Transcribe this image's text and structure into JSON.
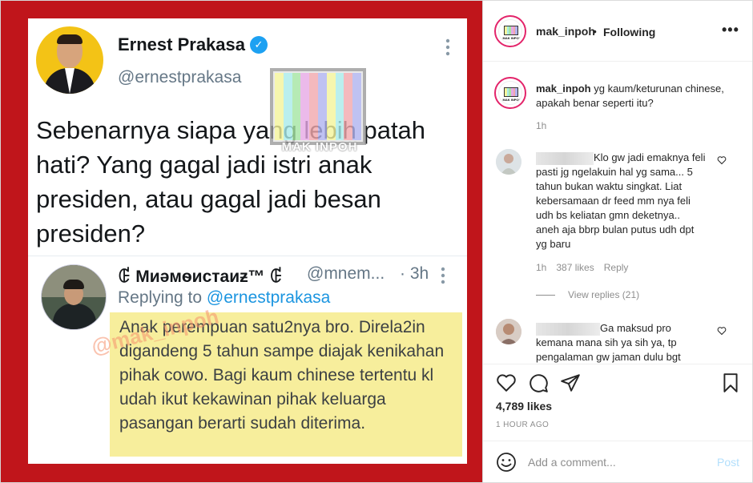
{
  "tweet": {
    "name": "Ernest Prakasa",
    "handle": "@ernestprakasa",
    "text": "Sebenarnya siapa yang lebih patah hati? Yang gagal jadi istri anak presiden, atau gagal jadi besan presiden?",
    "verified_glyph": "✓",
    "more_glyph": "⋮"
  },
  "quote": {
    "name": "ꂅ Mиәмѳиcтаиƶ™ ꂅ",
    "handle": "@mnem...",
    "time": "· 3h",
    "replying_prefix": "Replying to ",
    "replying_mention": "@ernestprakasa",
    "text": "Anak perempuan satu2nya bro. Direla2in digandeng 5 tahun sampe diajak kenikahan pihak cowo. Bagi kaum chinese tertentu kl udah ikut kekawinan pihak keluarga pasangan berarti sudah diterima.",
    "more_glyph": "⋮"
  },
  "watermark": {
    "logo_text": "MAK INPOH",
    "diagonal_text": "@mak_inpoh",
    "colors": [
      "#f4f49a",
      "#a9ecea",
      "#a5e6a3",
      "#e7a9e6",
      "#f2a8ad",
      "#b0b3f0",
      "#f4f49a",
      "#a9ecea",
      "#f2a8ad",
      "#b0b3f0"
    ]
  },
  "header": {
    "username": "mak_inpoh",
    "dot": "•",
    "follow_label": "Following",
    "more_label": "•••",
    "avatar_text": "MAK INPOH"
  },
  "caption": {
    "username": "mak_inpoh",
    "text": " yg kaum/keturunan chinese, apakah benar seperti itu?",
    "time": "1h"
  },
  "comments": [
    {
      "text": "Klo gw jadi emaknya feli pasti jg ngelakuin hal yg sama... 5 tahun bukan waktu singkat. Liat kebersamaan dr feed mm nya feli udh bs keliatan gmn deketnya.. aneh aja bbrp bulan putus udh dpt yg baru",
      "time": "1h",
      "likes": "387 likes",
      "reply": "Reply",
      "view_replies": "View replies (21)"
    },
    {
      "text": "Ga maksud pro kemana mana sih ya sih ya, tp pengalaman gw jaman dulu bgt"
    }
  ],
  "actions": {
    "likes": "4,789 likes",
    "time_ago": "1 HOUR AGO"
  },
  "add_comment": {
    "placeholder": "Add a comment...",
    "post_label": "Post"
  },
  "colors": {
    "ig_link": "#b2dffc",
    "twitter_blue": "#1da1f2",
    "post_bg": "#c0151b",
    "highlight": "#f7ee9c"
  }
}
